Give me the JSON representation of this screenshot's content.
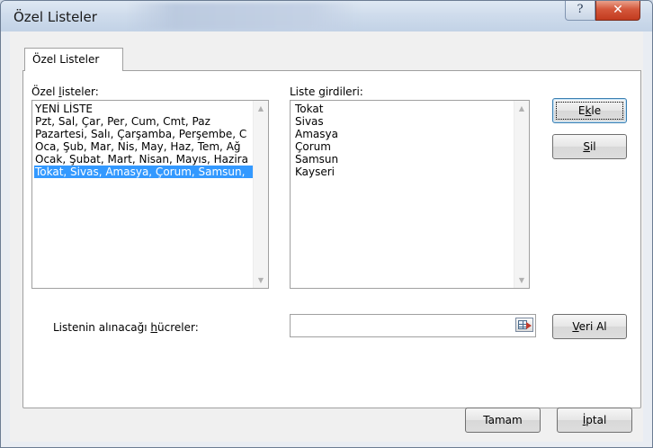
{
  "window": {
    "title": "Özel Listeler",
    "help_glyph": "?",
    "close_glyph": "✕"
  },
  "tabs": [
    {
      "label": "Özel Listeler"
    }
  ],
  "custom_lists": {
    "label_pre": "Özel ",
    "label_key": "l",
    "label_post": "isteler:",
    "items": [
      "YENİ LİSTE",
      "Pzt, Sal, Çar, Per, Cum, Cmt, Paz",
      "Pazartesi, Salı, Çarşamba, Perşembe, C",
      "Oca, Şub, Mar, Nis, May, Haz, Tem, Ağ",
      "Ocak, Şubat, Mart, Nisan, Mayıs, Hazira",
      "Tokat, Sivas, Amasya, Çorum, Samsun,"
    ],
    "selected_index": 5
  },
  "list_entries": {
    "label_pre": "Liste ",
    "label_key": "g",
    "label_post": "irdileri:",
    "items": [
      "Tokat",
      "Sivas",
      "Amasya",
      "Çorum",
      "Samsun",
      "Kayseri"
    ]
  },
  "buttons": {
    "add_pre": "E",
    "add_key": "k",
    "add_post": "le",
    "delete_pre": "",
    "delete_key": "S",
    "delete_post": "il",
    "import_pre": "",
    "import_key": "V",
    "import_post": "eri Al",
    "ok": "Tamam",
    "cancel_pre": "",
    "cancel_key": "İ",
    "cancel_post": "ptal"
  },
  "import_range": {
    "label_pre": "Listenin alınacağı ",
    "label_key": "h",
    "label_post": "ücreler:",
    "value": ""
  },
  "icons": {
    "scroll_up": "▲",
    "scroll_down": "▼"
  }
}
